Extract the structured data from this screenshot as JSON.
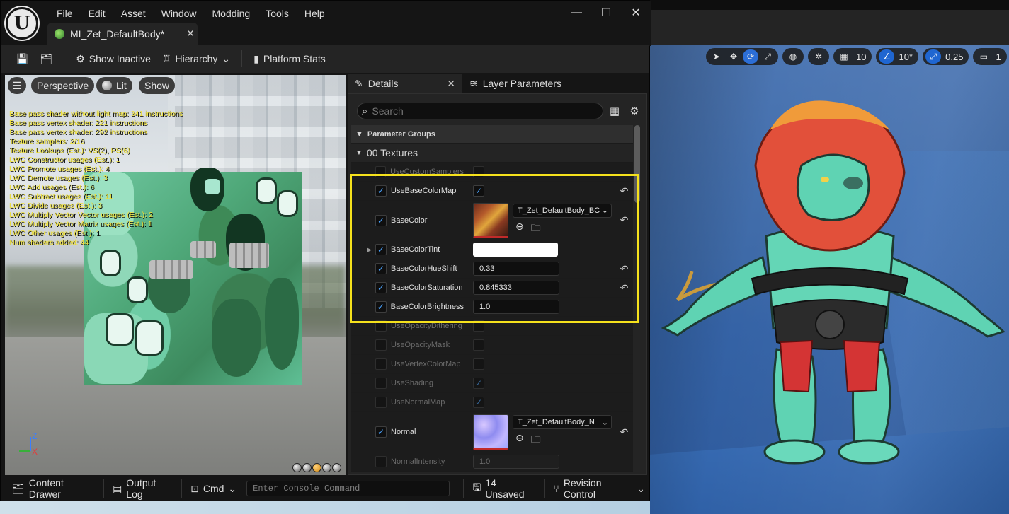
{
  "window": {
    "menu": [
      "File",
      "Edit",
      "Asset",
      "Window",
      "Modding",
      "Tools",
      "Help"
    ],
    "tab_title": "MI_Zet_DefaultBody*",
    "controls": {
      "minimize": "—",
      "maximize": "☐",
      "close": "✕"
    }
  },
  "toolbar": {
    "show_inactive": "Show Inactive",
    "hierarchy": "Hierarchy",
    "platform_stats": "Platform Stats"
  },
  "viewport": {
    "perspective": "Perspective",
    "lit": "Lit",
    "show": "Show",
    "stats": [
      "Base pass shader without light map: 341 instructions",
      "Base pass vertex shader: 221 instructions",
      "Base pass vertex shader: 292 instructions",
      "Texture samplers: 2/16",
      "Texture Lookups (Est.): VS(2), PS(6)",
      "LWC Constructor usages (Est.): 1",
      "LWC Promote usages (Est.): 4",
      "LWC Demote usages (Est.): 3",
      "LWC Add usages (Est.): 6",
      "LWC Subtract usages (Est.): 11",
      "LWC Divide usages (Est.): 3",
      "LWC Multiply Vector Vector usages (Est.): 2",
      "LWC Multiply Vector Matrix usages (Est.): 1",
      "LWC Other usages (Est.): 1",
      "Num shaders added: 44"
    ],
    "axis_z": "Z",
    "axis_x": "X"
  },
  "details": {
    "tab_details": "Details",
    "tab_layer": "Layer Parameters",
    "search_placeholder": "Search",
    "parameter_groups": "Parameter Groups",
    "group_textures": "00 Textures",
    "params": {
      "use_custom_samplers": "UseCustomSamplers",
      "use_base_color_map": "UseBaseColorMap",
      "base_color": "BaseColor",
      "base_color_asset": "T_Zet_DefaultBody_BC",
      "base_color_tint": "BaseColorTint",
      "hue_shift": "BaseColorHueShift",
      "hue_shift_value": "0.33",
      "saturation": "BaseColorSaturation",
      "saturation_value": "0.845333",
      "brightness": "BaseColorBrightness",
      "brightness_value": "1.0",
      "use_opacity_dithering": "UseOpacityDithering",
      "use_opacity_mask": "UseOpacityMask",
      "use_vertex_color_map": "UseVertexColorMap",
      "use_shading": "UseShading",
      "use_normal_map": "UseNormalMap",
      "normal": "Normal",
      "normal_asset": "T_Zet_DefaultBody_N",
      "normal_intensity": "NormalIntensity",
      "normal_intensity_value": "1.0"
    }
  },
  "bottombar": {
    "content_drawer": "Content Drawer",
    "output_log": "Output Log",
    "cmd": "Cmd",
    "console_placeholder": "Enter Console Command",
    "unsaved": "14 Unsaved",
    "revision_control": "Revision Control"
  },
  "bg_viewport": {
    "grid_size": "10",
    "angle": "10°",
    "scale": "0.25",
    "camera_speed": "1"
  },
  "colors": {
    "highlight": "#f5e11c",
    "accent": "#2c6ed6",
    "checkbox": "#4aa3ff"
  }
}
